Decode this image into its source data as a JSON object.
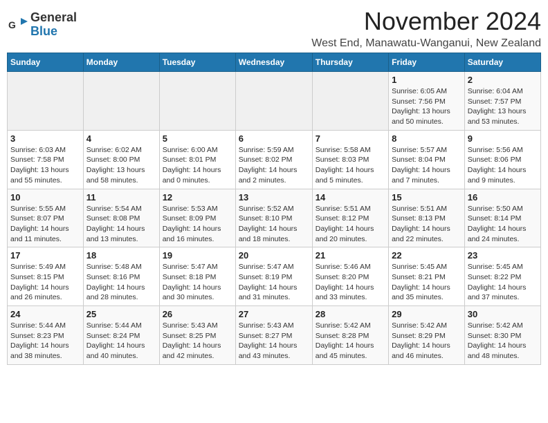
{
  "logo": {
    "general": "General",
    "blue": "Blue"
  },
  "title": "November 2024",
  "location": "West End, Manawatu-Wanganui, New Zealand",
  "days_of_week": [
    "Sunday",
    "Monday",
    "Tuesday",
    "Wednesday",
    "Thursday",
    "Friday",
    "Saturday"
  ],
  "weeks": [
    [
      {
        "day": "",
        "info": ""
      },
      {
        "day": "",
        "info": ""
      },
      {
        "day": "",
        "info": ""
      },
      {
        "day": "",
        "info": ""
      },
      {
        "day": "",
        "info": ""
      },
      {
        "day": "1",
        "info": "Sunrise: 6:05 AM\nSunset: 7:56 PM\nDaylight: 13 hours and 50 minutes."
      },
      {
        "day": "2",
        "info": "Sunrise: 6:04 AM\nSunset: 7:57 PM\nDaylight: 13 hours and 53 minutes."
      }
    ],
    [
      {
        "day": "3",
        "info": "Sunrise: 6:03 AM\nSunset: 7:58 PM\nDaylight: 13 hours and 55 minutes."
      },
      {
        "day": "4",
        "info": "Sunrise: 6:02 AM\nSunset: 8:00 PM\nDaylight: 13 hours and 58 minutes."
      },
      {
        "day": "5",
        "info": "Sunrise: 6:00 AM\nSunset: 8:01 PM\nDaylight: 14 hours and 0 minutes."
      },
      {
        "day": "6",
        "info": "Sunrise: 5:59 AM\nSunset: 8:02 PM\nDaylight: 14 hours and 2 minutes."
      },
      {
        "day": "7",
        "info": "Sunrise: 5:58 AM\nSunset: 8:03 PM\nDaylight: 14 hours and 5 minutes."
      },
      {
        "day": "8",
        "info": "Sunrise: 5:57 AM\nSunset: 8:04 PM\nDaylight: 14 hours and 7 minutes."
      },
      {
        "day": "9",
        "info": "Sunrise: 5:56 AM\nSunset: 8:06 PM\nDaylight: 14 hours and 9 minutes."
      }
    ],
    [
      {
        "day": "10",
        "info": "Sunrise: 5:55 AM\nSunset: 8:07 PM\nDaylight: 14 hours and 11 minutes."
      },
      {
        "day": "11",
        "info": "Sunrise: 5:54 AM\nSunset: 8:08 PM\nDaylight: 14 hours and 13 minutes."
      },
      {
        "day": "12",
        "info": "Sunrise: 5:53 AM\nSunset: 8:09 PM\nDaylight: 14 hours and 16 minutes."
      },
      {
        "day": "13",
        "info": "Sunrise: 5:52 AM\nSunset: 8:10 PM\nDaylight: 14 hours and 18 minutes."
      },
      {
        "day": "14",
        "info": "Sunrise: 5:51 AM\nSunset: 8:12 PM\nDaylight: 14 hours and 20 minutes."
      },
      {
        "day": "15",
        "info": "Sunrise: 5:51 AM\nSunset: 8:13 PM\nDaylight: 14 hours and 22 minutes."
      },
      {
        "day": "16",
        "info": "Sunrise: 5:50 AM\nSunset: 8:14 PM\nDaylight: 14 hours and 24 minutes."
      }
    ],
    [
      {
        "day": "17",
        "info": "Sunrise: 5:49 AM\nSunset: 8:15 PM\nDaylight: 14 hours and 26 minutes."
      },
      {
        "day": "18",
        "info": "Sunrise: 5:48 AM\nSunset: 8:16 PM\nDaylight: 14 hours and 28 minutes."
      },
      {
        "day": "19",
        "info": "Sunrise: 5:47 AM\nSunset: 8:18 PM\nDaylight: 14 hours and 30 minutes."
      },
      {
        "day": "20",
        "info": "Sunrise: 5:47 AM\nSunset: 8:19 PM\nDaylight: 14 hours and 31 minutes."
      },
      {
        "day": "21",
        "info": "Sunrise: 5:46 AM\nSunset: 8:20 PM\nDaylight: 14 hours and 33 minutes."
      },
      {
        "day": "22",
        "info": "Sunrise: 5:45 AM\nSunset: 8:21 PM\nDaylight: 14 hours and 35 minutes."
      },
      {
        "day": "23",
        "info": "Sunrise: 5:45 AM\nSunset: 8:22 PM\nDaylight: 14 hours and 37 minutes."
      }
    ],
    [
      {
        "day": "24",
        "info": "Sunrise: 5:44 AM\nSunset: 8:23 PM\nDaylight: 14 hours and 38 minutes."
      },
      {
        "day": "25",
        "info": "Sunrise: 5:44 AM\nSunset: 8:24 PM\nDaylight: 14 hours and 40 minutes."
      },
      {
        "day": "26",
        "info": "Sunrise: 5:43 AM\nSunset: 8:25 PM\nDaylight: 14 hours and 42 minutes."
      },
      {
        "day": "27",
        "info": "Sunrise: 5:43 AM\nSunset: 8:27 PM\nDaylight: 14 hours and 43 minutes."
      },
      {
        "day": "28",
        "info": "Sunrise: 5:42 AM\nSunset: 8:28 PM\nDaylight: 14 hours and 45 minutes."
      },
      {
        "day": "29",
        "info": "Sunrise: 5:42 AM\nSunset: 8:29 PM\nDaylight: 14 hours and 46 minutes."
      },
      {
        "day": "30",
        "info": "Sunrise: 5:42 AM\nSunset: 8:30 PM\nDaylight: 14 hours and 48 minutes."
      }
    ]
  ]
}
